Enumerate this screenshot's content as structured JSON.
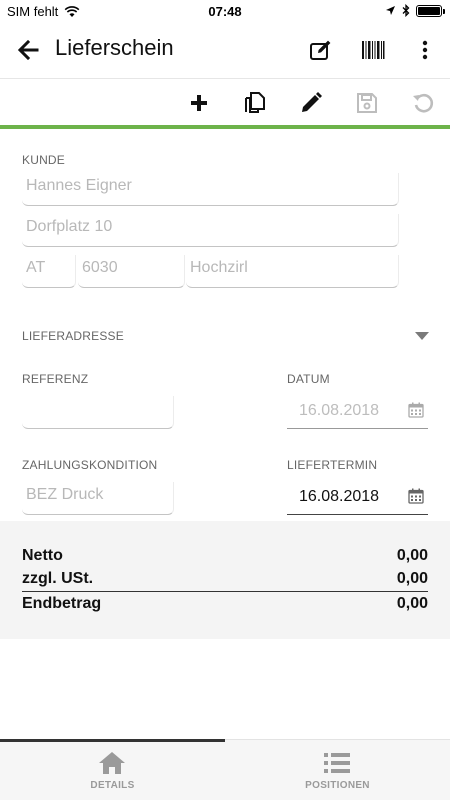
{
  "status_bar": {
    "carrier": "SIM fehlt",
    "time": "07:48",
    "wifi_icon": "wifi-icon",
    "location_icon": "location-arrow-icon",
    "bluetooth_icon": "bluetooth-icon",
    "battery_level": 1.0
  },
  "app_bar": {
    "title": "Lieferschein",
    "icons": [
      "back-arrow-icon",
      "edit-note-icon",
      "barcode-icon",
      "more-vert-icon"
    ]
  },
  "toolbar": {
    "icons": [
      "add-icon",
      "copy-icon",
      "pencil-icon",
      "save-icon",
      "undo-icon"
    ],
    "disabled": [
      "save-icon",
      "undo-icon"
    ]
  },
  "colors": {
    "accent": "#6db34a",
    "placeholder": "#b8b8b8",
    "label": "#666666",
    "totals_background": "#f4f4f4"
  },
  "customer": {
    "section_label": "KUNDE",
    "name_placeholder": "Hannes Eigner",
    "street_placeholder": "Dorfplatz 10",
    "country_placeholder": "AT",
    "zip_placeholder": "6030",
    "city_placeholder": "Hochzirl"
  },
  "delivery_address": {
    "section_label": "LIEFERADRESSE",
    "collapsed": true
  },
  "reference": {
    "label": "REFERENZ",
    "value": ""
  },
  "date": {
    "label": "DATUM",
    "value": "16.08.2018"
  },
  "payment_terms": {
    "label": "ZAHLUNGSKONDITION",
    "placeholder": "BEZ Druck"
  },
  "delivery_date": {
    "label": "LIEFERTERMIN",
    "value": "16.08.2018"
  },
  "totals": {
    "net_label": "Netto",
    "net_value": "0,00",
    "vat_label": "zzgl. USt.",
    "vat_value": "0,00",
    "total_label": "Endbetrag",
    "total_value": "0,00"
  },
  "tabs": [
    {
      "label": "DETAILS",
      "icon": "home-icon",
      "active": true
    },
    {
      "label": "POSITIONEN",
      "icon": "list-icon",
      "active": false
    }
  ]
}
